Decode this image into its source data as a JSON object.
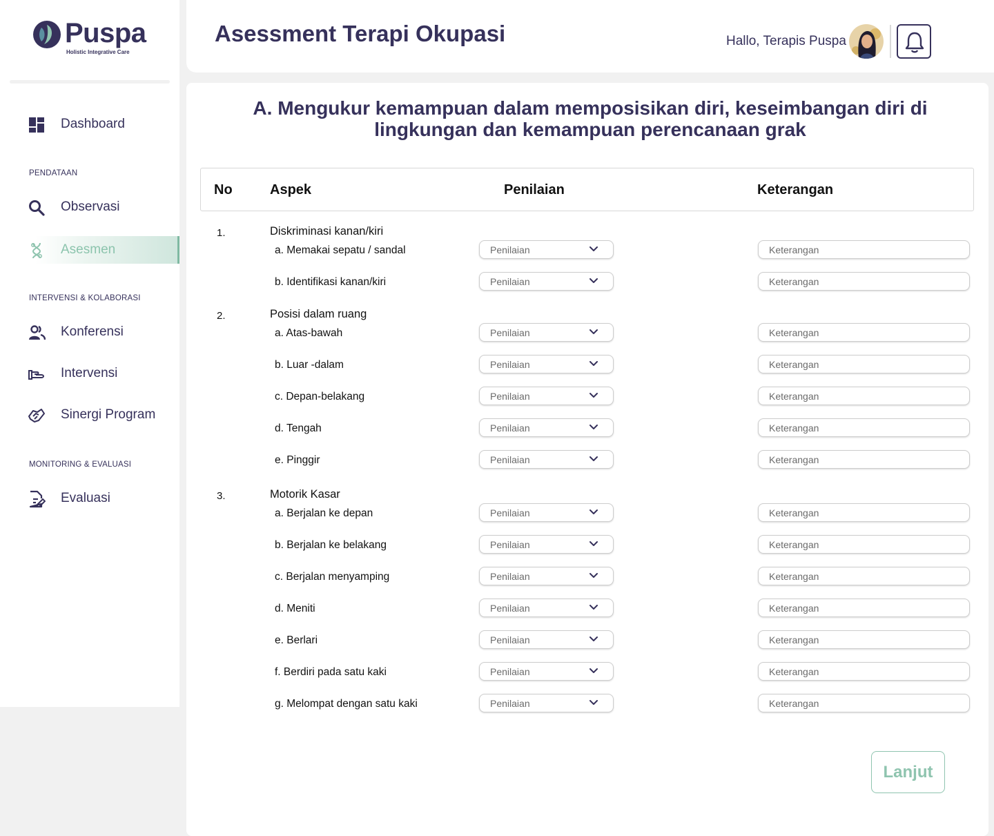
{
  "brand": {
    "name": "Puspa",
    "tagline": "Holistic Integrative Care"
  },
  "colors": {
    "primary": "#36315b",
    "accent": "#8fc4af",
    "background": "#f1f1f1"
  },
  "sidebar": {
    "dashboard": {
      "label": "Dashboard",
      "icon": "dashboard-icon"
    },
    "sections": [
      {
        "label": "PENDATAAN",
        "items": [
          {
            "label": "Observasi",
            "icon": "search-icon"
          },
          {
            "label": "Asesmen",
            "icon": "dna-icon",
            "active": true
          }
        ]
      },
      {
        "label": "INTERVENSI & KOLABORASI",
        "items": [
          {
            "label": "Konferensi",
            "icon": "people-icon"
          },
          {
            "label": "Intervensi",
            "icon": "hand-icon"
          },
          {
            "label": "Sinergi Program",
            "icon": "handshake-icon"
          }
        ]
      },
      {
        "label": "MONITORING & EVALUASI",
        "items": [
          {
            "label": "Evaluasi",
            "icon": "document-edit-icon"
          }
        ]
      }
    ]
  },
  "header": {
    "title": "Asessment Terapi Okupasi",
    "greeting": "Hallo, Terapis Puspa"
  },
  "main": {
    "section_title": "A. Mengukur kemampuan dalam memposisikan diri, keseimbangan diri di lingkungan dan kemampuan perencanaan grak",
    "columns": {
      "no": "No",
      "aspek": "Aspek",
      "penilaian": "Penilaian",
      "keterangan": "Keterangan"
    },
    "select_placeholder": "Penilaian",
    "input_placeholder": "Keterangan",
    "groups": [
      {
        "no": "1.",
        "title": "Diskriminasi kanan/kiri",
        "items": [
          "a. Memakai sepatu / sandal",
          "b. Identifikasi kanan/kiri"
        ]
      },
      {
        "no": "2.",
        "title": "Posisi dalam ruang",
        "items": [
          "a. Atas-bawah",
          "b. Luar -dalam",
          "c. Depan-belakang",
          "d. Tengah",
          "e. Pinggir"
        ]
      },
      {
        "no": "3.",
        "title": "Motorik Kasar",
        "items": [
          "a. Berjalan ke depan",
          "b. Berjalan ke belakang",
          "c. Berjalan menyamping",
          "d. Meniti",
          "e. Berlari",
          "f. Berdiri pada satu kaki",
          "g. Melompat dengan satu kaki"
        ]
      }
    ],
    "next_label": "Lanjut"
  }
}
